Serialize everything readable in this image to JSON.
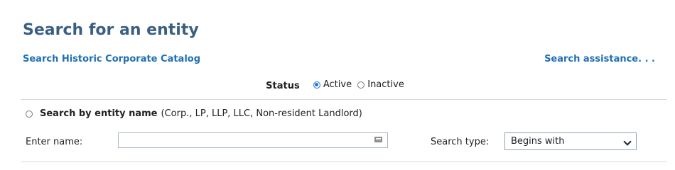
{
  "header": {
    "title": "Search for an entity",
    "historic_link": "Search Historic Corporate Catalog",
    "assistance_link": "Search assistance. . ."
  },
  "status": {
    "label": "Status",
    "options": [
      {
        "label": "Active",
        "checked": true
      },
      {
        "label": "Inactive",
        "checked": false
      }
    ]
  },
  "entity_search": {
    "title": "Search by entity name",
    "description": "(Corp., LP, LLP, LLC, Non-resident Landlord)",
    "name_label": "Enter name:",
    "name_value": "",
    "search_type_label": "Search type:",
    "search_type_value": "Begins with"
  },
  "colors": {
    "title": "#3a5f82",
    "link": "#1f6fb3",
    "radio_checked": "#1a73e8"
  }
}
